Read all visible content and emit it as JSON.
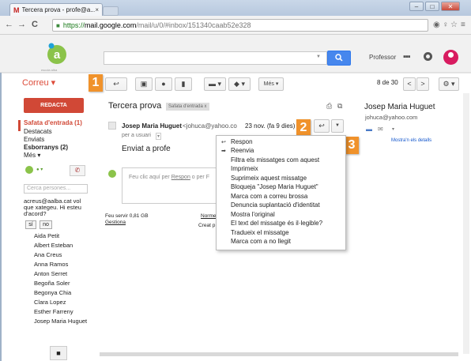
{
  "browser": {
    "tab_title": "Tercera prova - profe@a...",
    "tab_close": "×",
    "url_https": "https://",
    "url_domain": "mail.google.com",
    "url_path": "/mail/u/0/#inbox/151340caab52e328",
    "nav_back": "←",
    "nav_forward": "→",
    "nav_reload": "C",
    "window_min": "–",
    "window_max": "□",
    "window_close": "✕"
  },
  "header": {
    "logo_letter": "a",
    "logo_caption": "escola alba",
    "search_button_icon": "search-icon",
    "user_name": "Professor",
    "apps_glyph": "⋮⋮⋮",
    "accent_color": "#4787ed"
  },
  "toolbar": {
    "app_menu": "Correu ▾",
    "back_glyph": "↩",
    "archive_glyph": "▣",
    "spam_glyph": "❗",
    "delete_glyph": "🗑",
    "folder_glyph": "▬ ▾",
    "label_glyph": "◆ ▾",
    "more_label": "Més ▾",
    "pager": "8 de 30",
    "prev": "<",
    "next": ">",
    "settings_glyph": "⚙ ▾"
  },
  "callouts": [
    "1",
    "2",
    "3"
  ],
  "sidebar": {
    "compose_label": "REDACTA",
    "folders": [
      {
        "label": "Safata d'entrada (1)"
      },
      {
        "label": "Destacats"
      },
      {
        "label": "Enviats"
      },
      {
        "label": "Esborranys (2)"
      },
      {
        "label": "Més ▾"
      }
    ],
    "chat_search_placeholder": "Cerca persones...",
    "invite_text_1": "acreus@aalba.cat vol",
    "invite_text_2": "que xategeu. Hi esteu",
    "invite_text_3": "d'acord?",
    "invite_yes": "sí",
    "invite_no": "no",
    "contacts": [
      "Aida Petit",
      "Albert Esteban",
      "Ana Creus",
      "Anna Ramos",
      "Anton Serret",
      "Begoña Soler",
      "Begonya Chia",
      "Clara Lopez",
      "Esther Farreny",
      "Josep Maria Huguet"
    ]
  },
  "message": {
    "subject": "Tercera prova",
    "label": "Safata d'entrada",
    "label_close": "x",
    "sender_name": "Josep Maria Huguet",
    "sender_email": "<johuca@yahoo.co",
    "date": "23 nov. (fa 9 dies)",
    "recipient": "per a usuari",
    "body": "Enviat a profe",
    "reply_placeholder_pre": "Feu clic aquí per ",
    "reply_link": "Respon",
    "reply_placeholder_post": " o per F",
    "usage": "Feu servir 0,81 GB",
    "manage": "Gestiona",
    "terms": "Norme",
    "created": "Creat p"
  },
  "right_pane": {
    "name": "Josep Maria Huguet",
    "email": "johuca@yahoo.com",
    "show_details": "Mostra'n els detalls"
  },
  "dropdown_menu": {
    "items": [
      {
        "label": "Respon",
        "icon": "reply-icon"
      },
      {
        "label": "Reenvia",
        "icon": "forward-icon"
      },
      {
        "label": "Filtra els missatges com aquest",
        "icon": ""
      },
      {
        "label": "Imprimeix",
        "icon": ""
      },
      {
        "label": "Suprimeix aquest missatge",
        "icon": ""
      },
      {
        "label": "Bloqueja \"Josep Maria Huguet\"",
        "icon": ""
      },
      {
        "label": "Marca com a correu brossa",
        "icon": ""
      },
      {
        "label": "Denuncia suplantació d'identitat",
        "icon": ""
      },
      {
        "label": "Mostra l'original",
        "icon": ""
      },
      {
        "label": "El text del missatge és il·legible?",
        "icon": ""
      },
      {
        "label": "Tradueix el missatge",
        "icon": ""
      },
      {
        "label": "Marca com a no llegit",
        "icon": ""
      }
    ]
  }
}
